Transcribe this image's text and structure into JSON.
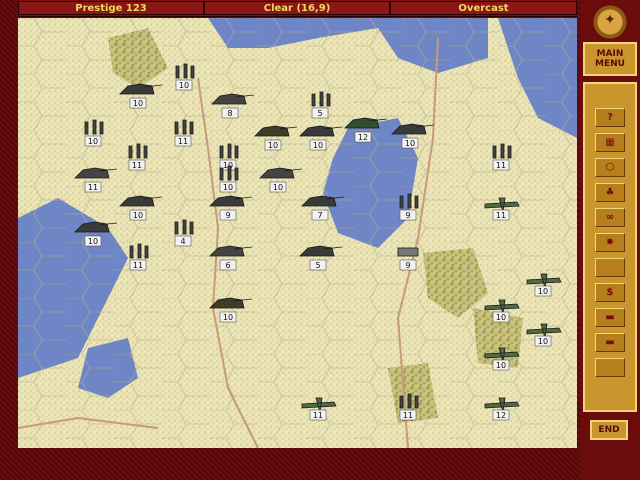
{
  "status_bar": {
    "prestige": "Prestige 123",
    "weather_coords": "Clear (16,9)",
    "sky": "Overcast"
  },
  "sidebar": {
    "main_menu_line1": "MAIN",
    "main_menu_line2": "MENU",
    "help_label": "?",
    "money_label": "$",
    "end_label": "END",
    "buttons": [
      "help-icon",
      "unit-list-icon",
      "hex-grid-icon",
      "terrain-icon",
      "air-mode-icon",
      "strength-icon",
      "blank",
      "purchase-icon",
      "deploy-icon",
      "next-unit-icon",
      "blank"
    ]
  },
  "colors": {
    "frame": "#5a0a0a",
    "panel_gold": "#c9962e",
    "status_text": "#f0d860",
    "map_plain": "#e9e3b4",
    "water": "#6f86c6",
    "forest": "#b9b56c",
    "road": "#c69a7a",
    "unit_axis": "#4a4a4a",
    "unit_soviet": "#3f5e3a"
  },
  "units": [
    {
      "type": "tank",
      "strength": "10"
    },
    {
      "type": "infantry",
      "strength": "10"
    },
    {
      "type": "artillery",
      "strength": "8"
    },
    {
      "type": "infantry",
      "strength": "5"
    },
    {
      "type": "armored-car",
      "strength": "12"
    },
    {
      "type": "tank",
      "strength": "10"
    },
    {
      "type": "infantry",
      "strength": "10"
    },
    {
      "type": "infantry",
      "strength": "11"
    },
    {
      "type": "infantry",
      "strength": "11"
    },
    {
      "type": "infantry",
      "strength": "10"
    },
    {
      "type": "artillery",
      "strength": "10"
    },
    {
      "type": "tank",
      "strength": "10"
    },
    {
      "type": "infantry",
      "strength": "11"
    },
    {
      "type": "artillery",
      "strength": "11"
    },
    {
      "type": "tank",
      "strength": "10"
    },
    {
      "type": "infantry",
      "strength": "10"
    },
    {
      "type": "assault-gun",
      "strength": "10"
    },
    {
      "type": "tank",
      "strength": "9"
    },
    {
      "type": "tank",
      "strength": "7"
    },
    {
      "type": "infantry",
      "strength": "9"
    },
    {
      "type": "aircraft",
      "strength": "11"
    },
    {
      "type": "tank",
      "strength": "10"
    },
    {
      "type": "infantry",
      "strength": "4"
    },
    {
      "type": "infantry",
      "strength": "11"
    },
    {
      "type": "artillery",
      "strength": "6"
    },
    {
      "type": "tank",
      "strength": "5"
    },
    {
      "type": "bunker",
      "strength": "9"
    },
    {
      "type": "aircraft",
      "strength": "10"
    },
    {
      "type": "aircraft",
      "strength": "10"
    },
    {
      "type": "aircraft",
      "strength": "10"
    },
    {
      "type": "assault-gun",
      "strength": "10"
    },
    {
      "type": "aircraft",
      "strength": "10"
    },
    {
      "type": "aircraft",
      "strength": "11"
    },
    {
      "type": "infantry",
      "strength": "11"
    },
    {
      "type": "aircraft",
      "strength": "12"
    }
  ]
}
